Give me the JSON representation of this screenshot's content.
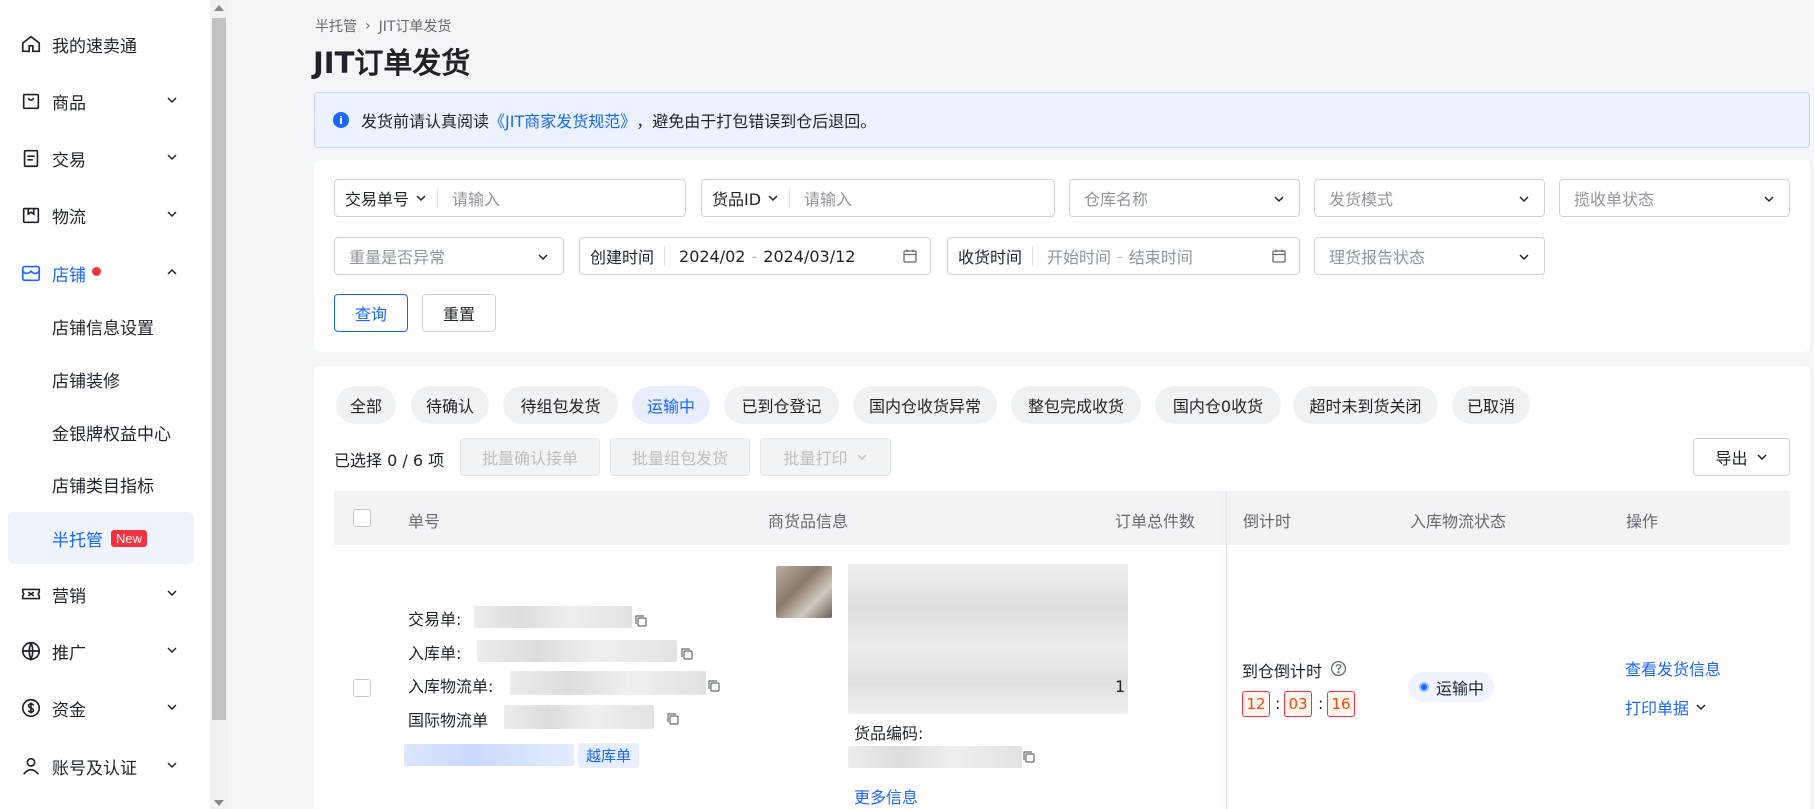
{
  "sidebar": {
    "items": [
      {
        "label": "我的速卖通",
        "icon": "home-icon",
        "expandable": false
      },
      {
        "label": "商品",
        "icon": "bag-icon",
        "expandable": true
      },
      {
        "label": "交易",
        "icon": "clipboard-icon",
        "expandable": true
      },
      {
        "label": "物流",
        "icon": "package-icon",
        "expandable": true
      },
      {
        "label": "店铺",
        "icon": "store-icon",
        "expandable": true,
        "active": true
      },
      {
        "label": "营销",
        "icon": "ticket-icon",
        "expandable": true
      },
      {
        "label": "推广",
        "icon": "globe-icon",
        "expandable": true
      },
      {
        "label": "资金",
        "icon": "dollar-icon",
        "expandable": true
      },
      {
        "label": "账号及认证",
        "icon": "user-icon",
        "expandable": true
      }
    ],
    "sub_items": [
      {
        "label": "店铺信息设置"
      },
      {
        "label": "店铺装修"
      },
      {
        "label": "金银牌权益中心"
      },
      {
        "label": "店铺类目指标"
      },
      {
        "label": "半托管",
        "badge": "New",
        "selected": true
      }
    ]
  },
  "breadcrumb": {
    "root": "半托管",
    "current": "JIT订单发货"
  },
  "page_title": "JIT订单发货",
  "alert": {
    "prefix": "发货前请认真阅读",
    "link": "《JIT商家发货规范》",
    "suffix": "，避免由于打包错误到仓后退回。"
  },
  "filters": {
    "trade_no_label": "交易单号",
    "trade_no_placeholder": "请输入",
    "goods_id_label": "货品ID",
    "goods_id_placeholder": "请输入",
    "warehouse_placeholder": "仓库名称",
    "ship_mode_placeholder": "发货模式",
    "pickup_status_placeholder": "揽收单状态",
    "weight_abnormal_placeholder": "重量是否异常",
    "created_label": "创建时间",
    "created_start": "2024/02",
    "created_end": "2024/03/12",
    "received_label": "收货时间",
    "received_start": "开始时间",
    "received_end": "结束时间",
    "claim_status_placeholder": "理货报告状态",
    "query_btn": "查询",
    "reset_btn": "重置"
  },
  "tabs": [
    {
      "label": "全部"
    },
    {
      "label": "待确认"
    },
    {
      "label": "待组包发货"
    },
    {
      "label": "运输中",
      "active": true
    },
    {
      "label": "已到仓登记"
    },
    {
      "label": "国内仓收货异常"
    },
    {
      "label": "整包完成收货"
    },
    {
      "label": "国内仓0收货"
    },
    {
      "label": "超时未到货关闭"
    },
    {
      "label": "已取消"
    }
  ],
  "toolbar": {
    "selected_text": "已选择 0 / 6 项",
    "batch_confirm": "批量确认接单",
    "batch_ship": "批量组包发货",
    "batch_print": "批量打印",
    "export": "导出"
  },
  "table": {
    "headers": [
      "单号",
      "商货品信息",
      "订单总件数",
      "倒计时",
      "入库物流状态",
      "操作"
    ],
    "row": {
      "trade_label": "交易单:",
      "inbound_label": "入库单:",
      "inbound_logistics_label": "入库物流单:",
      "intl_logistics_label": "国际物流单",
      "tag": "越库单",
      "goods_code_label": "货品编码:",
      "more_info": "更多信息",
      "total_qty": "1",
      "countdown_label": "到仓倒计时",
      "countdown": {
        "h": "12",
        "m": "03",
        "s": "16"
      },
      "status": "运输中",
      "action_view": "查看发货信息",
      "action_print": "打印单据"
    }
  },
  "colors": {
    "accent": "#1a66ff",
    "danger": "#f5333f",
    "bg": "#f4f5f7"
  }
}
